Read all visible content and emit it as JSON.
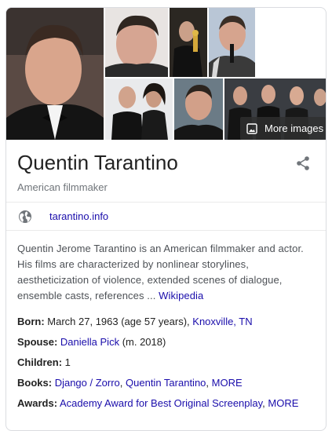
{
  "images": {
    "tiles": [
      {
        "subject": "portrait-closeup-bowtie"
      },
      {
        "subject": "portrait-closeup"
      },
      {
        "subject": "holding-oscar-award"
      },
      {
        "subject": "at-microphone"
      },
      {
        "subject": "with-woman-red-carpet"
      },
      {
        "subject": "portrait-smiling"
      },
      {
        "subject": "group-in-tuxedos"
      }
    ],
    "more_label": "More images",
    "more_icon": "image-gallery-icon"
  },
  "header": {
    "title": "Quentin Tarantino",
    "subtitle": "American filmmaker",
    "share_icon": "share-icon"
  },
  "website": {
    "icon": "globe-icon",
    "label": "tarantino.info"
  },
  "description": {
    "text": "Quentin Jerome Tarantino is an American filmmaker and actor. His films are characterized by nonlinear storylines, aestheticization of violence, extended scenes of dialogue, ensemble casts, references ... ",
    "source_link": "Wikipedia"
  },
  "facts": {
    "born": {
      "label": "Born:",
      "value": " March 27, 1963 (age 57 years), ",
      "place": "Knoxville, TN"
    },
    "spouse": {
      "label": "Spouse:",
      "name": "Daniella Pick",
      "value": " (m. 2018)"
    },
    "children": {
      "label": "Children:",
      "value": " 1"
    },
    "books": {
      "label": "Books:",
      "items": [
        "Django / Zorro",
        "Quentin Tarantino"
      ],
      "separator": ", ",
      "more": "MORE"
    },
    "awards": {
      "label": "Awards:",
      "items": [
        "Academy Award for Best Original Screenplay"
      ],
      "separator": ", ",
      "more": "MORE"
    }
  },
  "colors": {
    "link": "#1a0dab",
    "secondary_text": "#70757a",
    "border": "#dadce0"
  }
}
